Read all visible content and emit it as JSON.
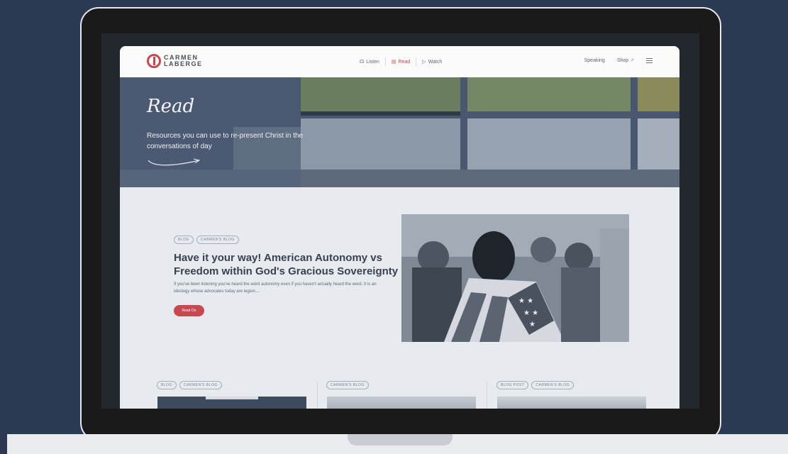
{
  "header": {
    "logo_line1": "CARMEN",
    "logo_line2": "LABERGE",
    "nav": [
      {
        "label": "Listen",
        "icon": "headphones-icon"
      },
      {
        "label": "Read",
        "icon": "book-icon"
      },
      {
        "label": "Watch",
        "icon": "video-icon"
      }
    ],
    "speaking": "Speaking",
    "shop": "Shop",
    "shop_icon": "⇗"
  },
  "hero": {
    "title": "Read",
    "subtitle": "Resources you can use to re-present Christ in the conversations of day"
  },
  "featured": {
    "badges": [
      "BLOG",
      "CARMEN'S BLOG"
    ],
    "title": "Have it your way! American Autonomy vs Freedom within God's Gracious Sovereignty",
    "excerpt": "If you've been listening you've heard the word autonomy even if you haven't actually heard the word. It is an ideology whose advocates today are legion....",
    "button": "Read On"
  },
  "cards": [
    {
      "badges": [
        "BLOG",
        "CARMEN'S BLOG"
      ]
    },
    {
      "badges": [
        "CARMEN'S BLOG"
      ]
    },
    {
      "badges": [
        "BLOG POST",
        "CARMEN'S BLOG"
      ]
    }
  ],
  "colors": {
    "accent": "#c7484f",
    "page_bg": "#2b3a52",
    "hero_bg": "#43526a"
  }
}
